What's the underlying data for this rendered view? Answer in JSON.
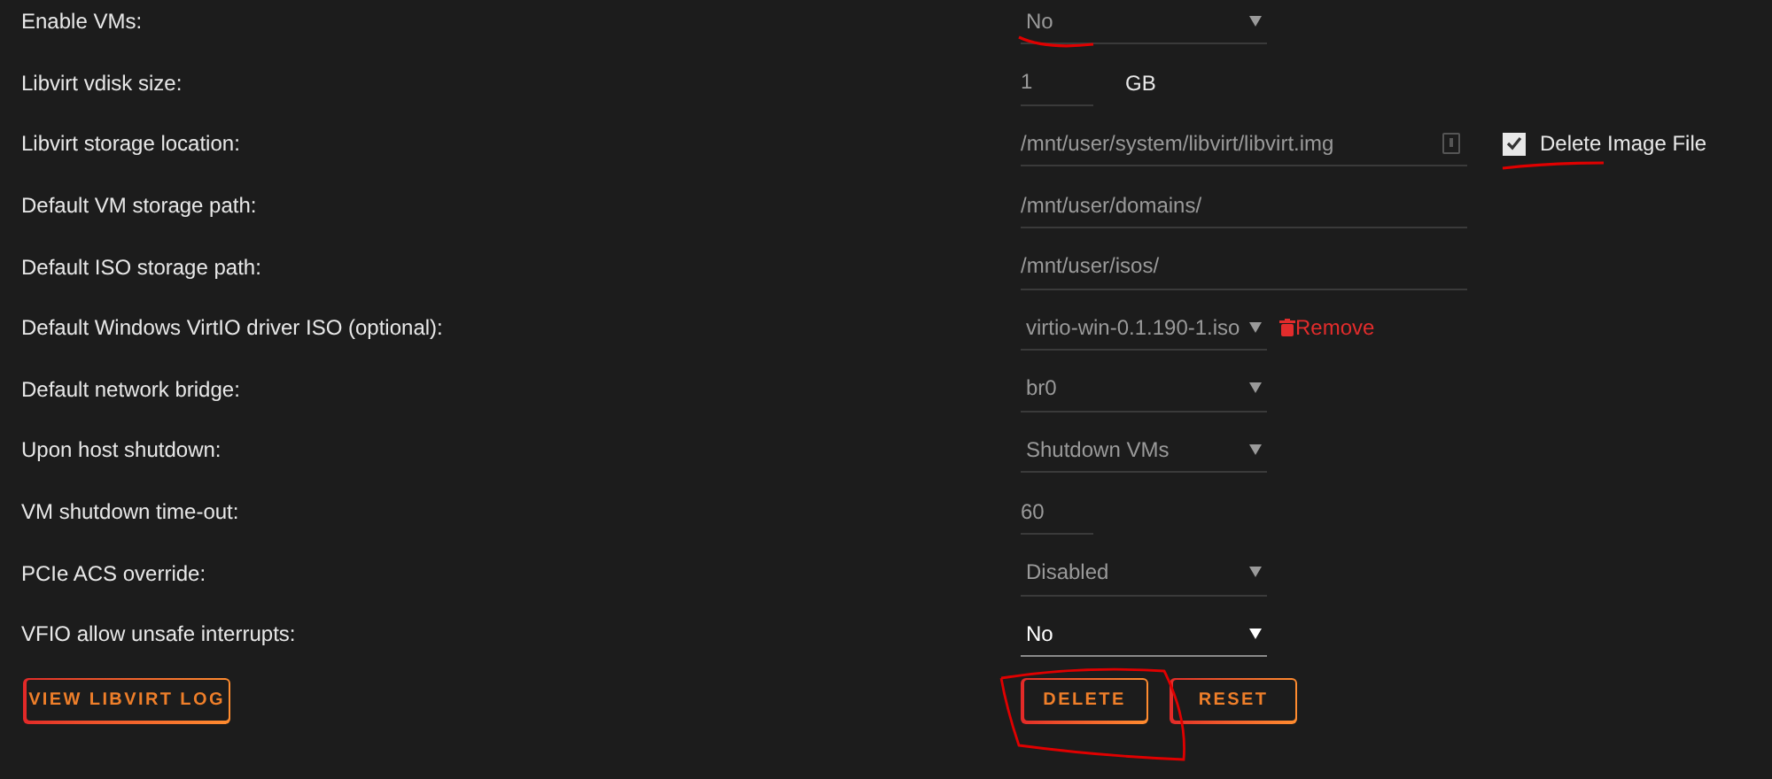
{
  "settings": [
    {
      "label": "Enable VMs:",
      "kind": "select",
      "value": "No",
      "disabled": true
    },
    {
      "label": "Libvirt vdisk size:",
      "kind": "number",
      "value": "1",
      "unit": "GB",
      "disabled": true
    },
    {
      "label": "Libvirt storage location:",
      "kind": "path",
      "value": "/mnt/user/system/libvirt/libvirt.img",
      "disabled": true,
      "checkbox": {
        "label": "Delete Image File",
        "checked": true
      }
    },
    {
      "label": "Default VM storage path:",
      "kind": "text",
      "value": "/mnt/user/domains/",
      "disabled": true
    },
    {
      "label": "Default ISO storage path:",
      "kind": "text",
      "value": "/mnt/user/isos/",
      "disabled": true
    },
    {
      "label": "Default Windows VirtIO driver ISO (optional):",
      "kind": "select",
      "value": "virtio-win-0.1.190-1.iso",
      "disabled": true,
      "remove": "Remove"
    },
    {
      "label": "Default network bridge:",
      "kind": "select",
      "value": "br0",
      "disabled": true
    },
    {
      "label": "Upon host shutdown:",
      "kind": "select",
      "value": "Shutdown VMs",
      "disabled": true
    },
    {
      "label": "VM shutdown time-out:",
      "kind": "number",
      "value": "60",
      "disabled": true
    },
    {
      "label": "PCIe ACS override:",
      "kind": "select",
      "value": "Disabled",
      "disabled": true
    },
    {
      "label": "VFIO allow unsafe interrupts:",
      "kind": "select",
      "value": "No",
      "disabled": false
    }
  ],
  "buttons": {
    "left": [
      {
        "label": "VIEW LIBVIRT LOG"
      }
    ],
    "right": [
      {
        "label": "DELETE"
      },
      {
        "label": "RESET"
      }
    ]
  }
}
